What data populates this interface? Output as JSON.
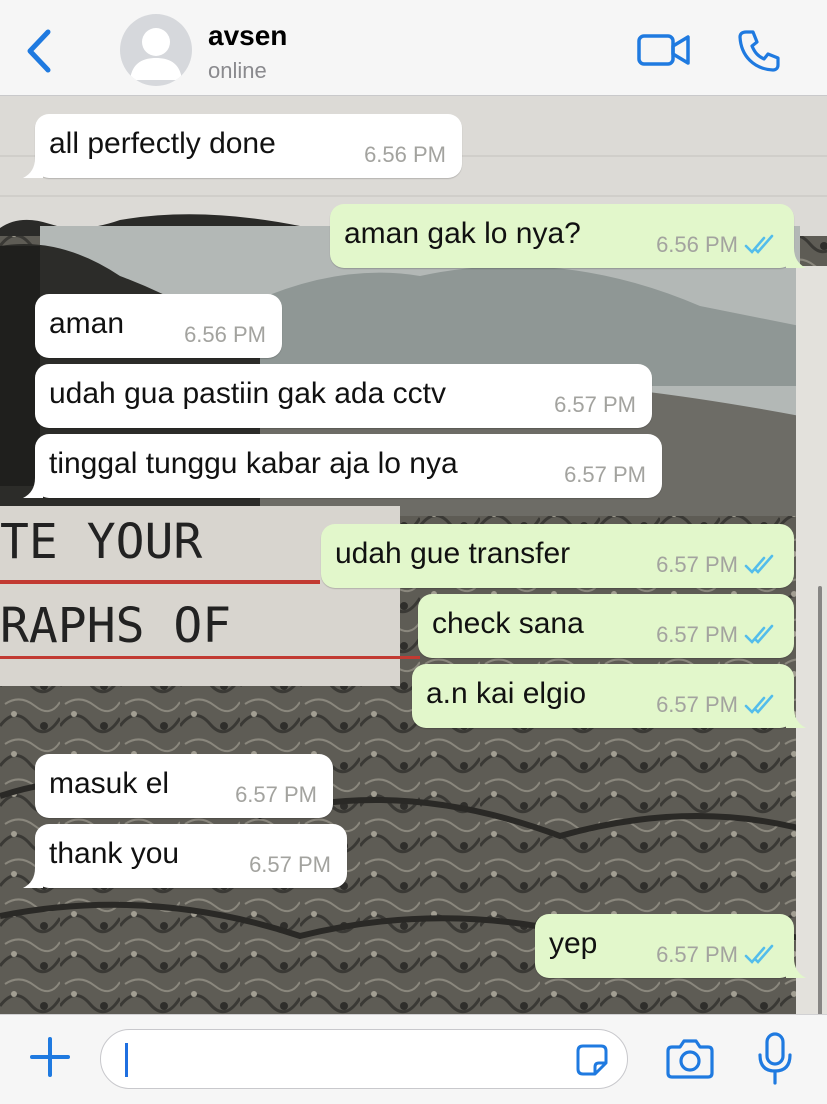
{
  "header": {
    "contact_name": "avsen",
    "status": "online",
    "icons": {
      "back": "chevron-left-icon",
      "avatar": "default-avatar-icon",
      "video": "video-camera-icon",
      "call": "phone-icon"
    }
  },
  "colors": {
    "accent": "#1f7ae0",
    "incoming_bubble": "#ffffff",
    "outgoing_bubble": "#e2f7cb",
    "read_ticks": "#53bdeb",
    "timestamp": "#a3a39f"
  },
  "messages": [
    {
      "direction": "in",
      "text": "all perfectly done",
      "time": "6.56 PM"
    },
    {
      "direction": "out",
      "text": "aman gak lo nya?",
      "time": "6.56 PM",
      "status": "read"
    },
    {
      "direction": "in",
      "text": "aman",
      "time": "6.56 PM"
    },
    {
      "direction": "in",
      "text": "udah gua pastiin gak ada cctv",
      "time": "6.57 PM"
    },
    {
      "direction": "in",
      "text": "tinggal tunggu kabar aja lo nya",
      "time": "6.57 PM"
    },
    {
      "direction": "out",
      "text": "udah gue transfer",
      "time": "6.57 PM",
      "status": "read"
    },
    {
      "direction": "out",
      "text": "check sana",
      "time": "6.57 PM",
      "status": "read"
    },
    {
      "direction": "out",
      "text": "a.n kai elgio",
      "time": "6.57 PM",
      "status": "read"
    },
    {
      "direction": "in",
      "text": "masuk el",
      "time": "6.57 PM"
    },
    {
      "direction": "in",
      "text": "thank you",
      "time": "6.57 PM"
    },
    {
      "direction": "out",
      "text": "yep",
      "time": "6.57 PM",
      "status": "read"
    }
  ],
  "wallpaper": {
    "text_line_1": "TE YOUR",
    "text_line_2": "RAPHS OF"
  },
  "input": {
    "value": "",
    "icons": {
      "attach": "plus-icon",
      "sticker": "sticker-icon",
      "camera": "camera-icon",
      "mic": "microphone-icon"
    }
  }
}
